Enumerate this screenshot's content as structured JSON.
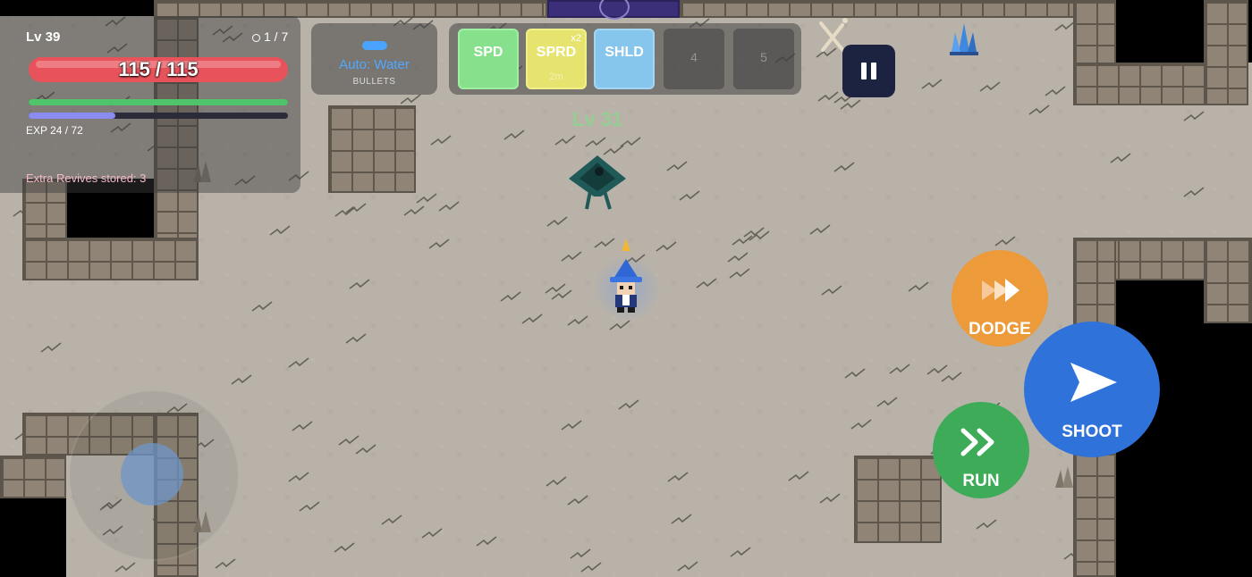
{
  "hud": {
    "level_label": "Lv 39",
    "kills_label": "1 / 7",
    "hp_text": "115 / 115",
    "hp_fraction": 1.0,
    "stamina_fraction": 1.0,
    "exp_fraction": 0.333,
    "exp_text": "EXP 24 / 72",
    "revives_text": "Extra Revives stored: 3"
  },
  "ammo": {
    "mode_label": "Auto: Water",
    "type_label": "BULLETS"
  },
  "powerups": [
    {
      "label": "SPD",
      "color": "#86e08c"
    },
    {
      "label": "SPRD",
      "color": "#e6e36e",
      "multiplier": "x2",
      "duration": "2m"
    },
    {
      "label": "SHLD",
      "color": "#86c6ec"
    },
    {
      "label": "4"
    },
    {
      "label": "5"
    }
  ],
  "enemy": {
    "level_label": "Lv 31"
  },
  "controls": {
    "dodge_label": "DODGE",
    "shoot_label": "SHOOT",
    "run_label": "RUN"
  },
  "icons": {
    "pause": "pause-icon",
    "dodge": "double-arrow-right-icon",
    "shoot": "paper-plane-icon",
    "run": "chevrons-right-icon"
  },
  "colors": {
    "dodge": "#ec9a3a",
    "shoot": "#2f72d9",
    "run": "#3dab57",
    "hp": "#e8535b",
    "stamina": "#4fc46a",
    "exp": "#8b8cf0"
  }
}
